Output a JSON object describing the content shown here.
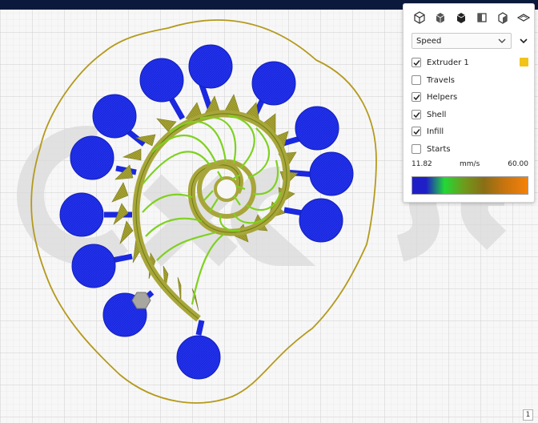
{
  "view_panel": {
    "icons": [
      "iso-view-icon",
      "front-view-icon",
      "top-view-icon",
      "left-view-icon",
      "right-view-icon",
      "layer-view-icon"
    ],
    "mode": {
      "selected": "Speed"
    },
    "options": [
      {
        "id": "extruder-1",
        "label": "Extruder 1",
        "checked": true,
        "color": "#f0c419"
      },
      {
        "id": "travels",
        "label": "Travels",
        "checked": false
      },
      {
        "id": "helpers",
        "label": "Helpers",
        "checked": true
      },
      {
        "id": "shell",
        "label": "Shell",
        "checked": true
      },
      {
        "id": "infill",
        "label": "Infill",
        "checked": true
      },
      {
        "id": "starts",
        "label": "Starts",
        "checked": false
      }
    ],
    "legend": {
      "min": "11.82",
      "unit": "mm/s",
      "max": "60.00",
      "gradient_colors": [
        "#1f1fc8",
        "#23d836",
        "#6b8a1a",
        "#d6780f",
        "#f4820a"
      ]
    }
  },
  "page_indicator": "1",
  "colors": {
    "top_bar": "#0b1a3c",
    "blue_pads": "#1a28e0",
    "shell": "#a8a63a",
    "infill": "#7fd11f",
    "skirt": "#c0a020",
    "build_plate_grid": "#e3e3e3"
  }
}
